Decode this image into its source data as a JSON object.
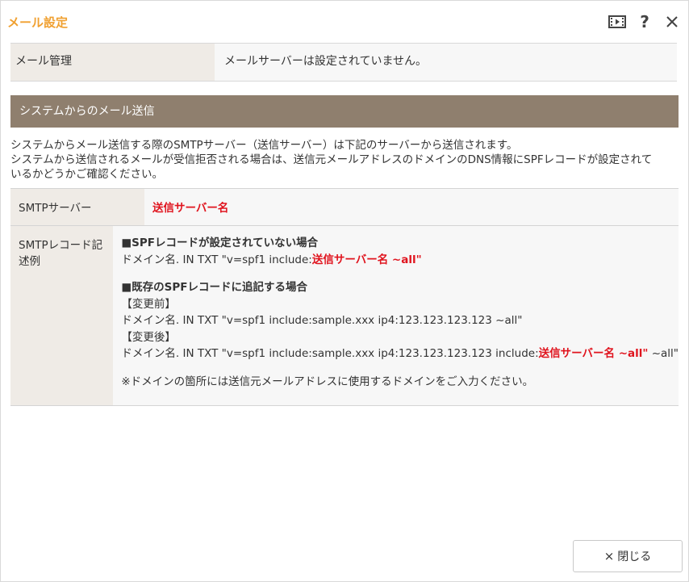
{
  "header": {
    "title": "メール設定",
    "icons": [
      "film-icon",
      "help-icon",
      "close-icon"
    ]
  },
  "mail_management": {
    "label": "メール管理",
    "value": "メールサーバーは設定されていません。"
  },
  "section": {
    "title": "システムからのメール送信",
    "description": [
      "システムからメール送信する際のSMTPサーバー（送信サーバー）は下記のサーバーから送信されます。",
      "システムから送信されるメールが受信拒否される場合は、送信元メールアドレスのドメインのDNS情報にSPFレコードが設定されて",
      "いるかどうかご確認ください。"
    ]
  },
  "smtp": {
    "label": "SMTPサーバー",
    "value": "送信サーバー名"
  },
  "record": {
    "label": "SMTPレコード記述例",
    "case1": {
      "heading": "■SPFレコードが設定されていない場合",
      "line_prefix": "ドメイン名. IN TXT \"v=spf1 include:",
      "line_highlight": "送信サーバー名 ~all\""
    },
    "case2": {
      "heading": "■既存のSPFレコードに追記する場合",
      "before_label": "【変更前】",
      "before_line": "ドメイン名. IN TXT \"v=spf1 include:sample.xxx ip4:123.123.123.123 ~all\"",
      "after_label": "【変更後】",
      "after_prefix": "ドメイン名. IN TXT \"v=spf1 include:sample.xxx ip4:123.123.123.123 include:",
      "after_highlight": "送信サーバー名 ~all\"",
      "after_suffix": " ~all\""
    },
    "note": "※ドメインの箇所には送信元メールアドレスに使用するドメインをご入力ください。"
  },
  "footer": {
    "close_icon": "×",
    "close_label": "閉じる"
  },
  "colors": {
    "title": "#f0a030",
    "section_header": "#8f7f6e",
    "highlight": "#e0141e"
  }
}
